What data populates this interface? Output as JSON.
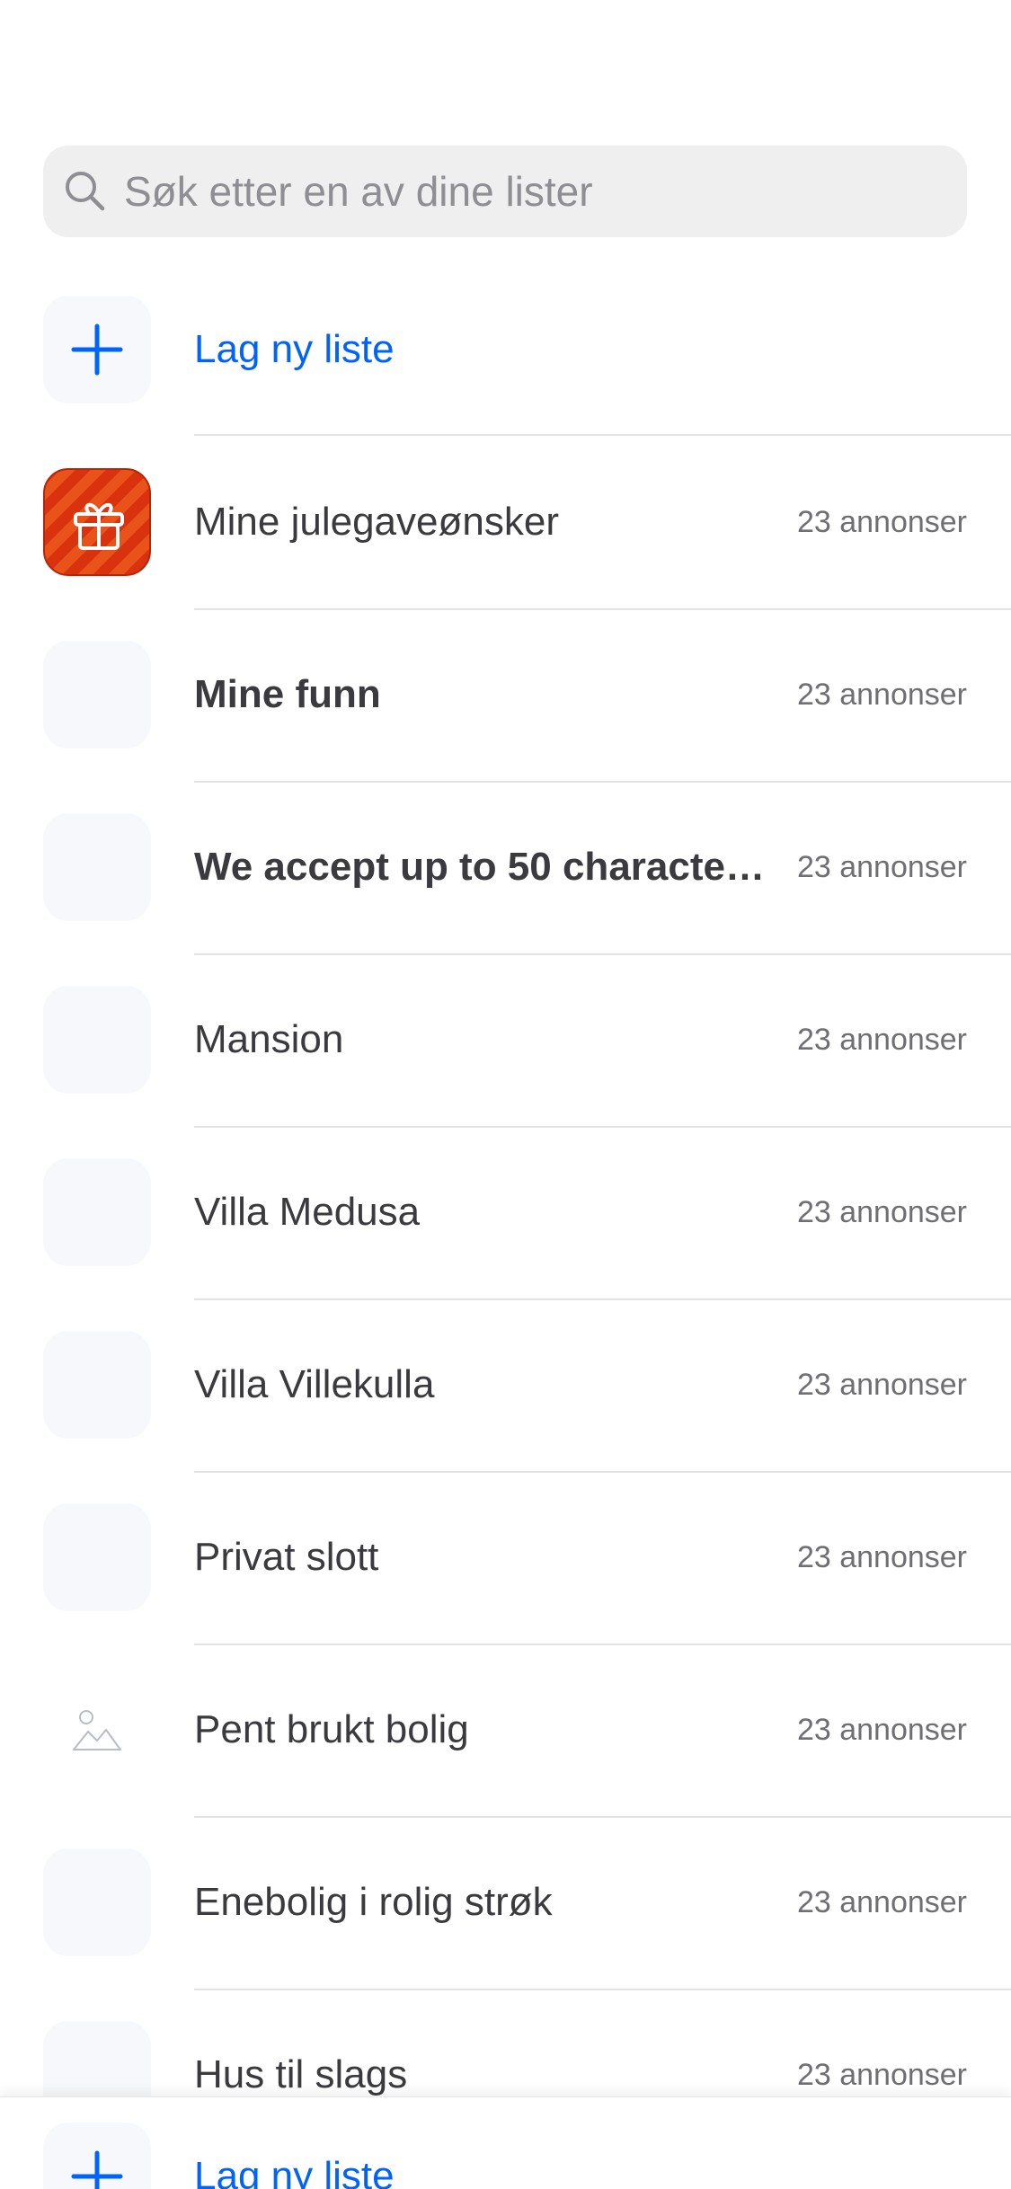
{
  "search": {
    "placeholder": "Søk etter en av dine lister",
    "value": ""
  },
  "new_list": {
    "label": "Lag ny liste"
  },
  "lists": [
    {
      "name": "Mine julegaveønsker",
      "count": "23 annonser",
      "bold": false,
      "thumb": "gift-icon"
    },
    {
      "name": "Mine funn",
      "count": "23 annonser",
      "bold": true,
      "thumb": "empty"
    },
    {
      "name": "We accept up to 50 characte…",
      "count": "23 annonser",
      "bold": true,
      "thumb": "empty"
    },
    {
      "name": "Mansion",
      "count": "23 annonser",
      "bold": false,
      "thumb": "empty"
    },
    {
      "name": "Villa Medusa",
      "count": "23 annonser",
      "bold": false,
      "thumb": "empty"
    },
    {
      "name": "Villa Villekulla",
      "count": "23 annonser",
      "bold": false,
      "thumb": "empty"
    },
    {
      "name": "Privat slott",
      "count": "23 annonser",
      "bold": false,
      "thumb": "empty"
    },
    {
      "name": "Pent brukt bolig",
      "count": "23 annonser",
      "bold": false,
      "thumb": "image-placeholder-icon"
    },
    {
      "name": "Enebolig i rolig strøk",
      "count": "23 annonser",
      "bold": false,
      "thumb": "empty"
    },
    {
      "name": "Hus til slags",
      "count": "23 annonser",
      "bold": false,
      "thumb": "empty"
    }
  ],
  "bottom_bar": {
    "label": "Lag ny liste"
  },
  "colors": {
    "accent": "#0063fb",
    "text": "#3b3b3f",
    "muted": "#6e6e73",
    "gift": "#d8320e"
  }
}
